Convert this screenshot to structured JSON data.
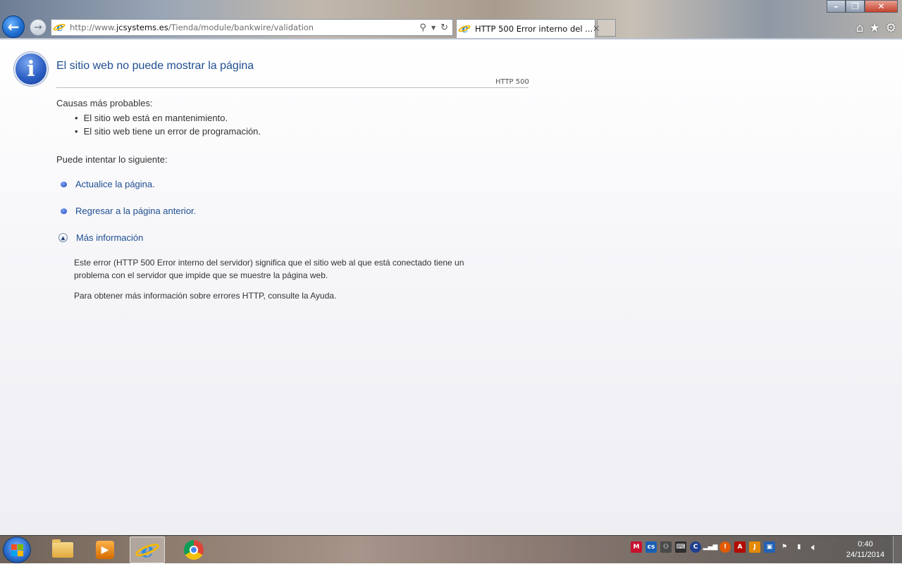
{
  "browser": {
    "address": {
      "url_prefix": "http://www.",
      "url_host": "jcsystems.es",
      "url_path": "/Tienda/module/bankwire/validation"
    },
    "tab": {
      "title": "HTTP 500 Error interno del ...",
      "close": "✕"
    },
    "window_controls": {
      "minimize": "–",
      "maximize": "❐",
      "close": "✕"
    },
    "toolbar_icons": [
      "home-icon",
      "favorites-star-icon",
      "settings-gear-icon"
    ]
  },
  "error_page": {
    "title": "El sitio web no puede mostrar la página",
    "code": "HTTP 500",
    "causes_heading": "Causas más probables:",
    "causes": [
      "El sitio web está en mantenimiento.",
      "El sitio web tiene un error de programación."
    ],
    "try_heading": "Puede intentar lo siguiente:",
    "actions": [
      "Actualice la página.",
      "Regresar a la página anterior."
    ],
    "more_info_label": "Más información",
    "more_info_paragraph": "Este error (HTTP 500 Error interno del servidor) significa que el sitio web al que está conectado tiene un problema con el servidor que impide que se muestre la página web.",
    "help_paragraph": "Para obtener más información sobre errores HTTP, consulte la Ayuda."
  },
  "taskbar": {
    "pinned": [
      "file-explorer-icon",
      "media-player-icon",
      "internet-explorer-icon",
      "chrome-icon"
    ],
    "clock": {
      "time": "0:40",
      "date": "24/11/2014"
    }
  }
}
